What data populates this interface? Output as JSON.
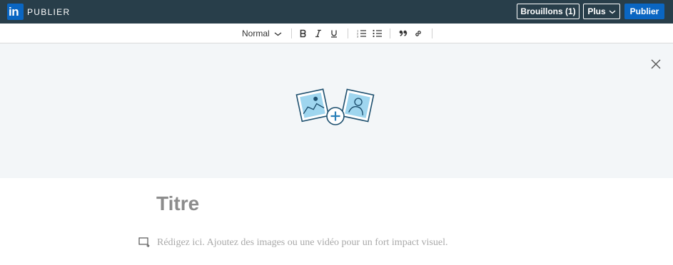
{
  "header": {
    "logo_text": "in",
    "brand_label": "PUBLIER",
    "drafts_label": "Brouillons (1)",
    "more_label": "Plus",
    "publish_label": "Publier"
  },
  "toolbar": {
    "text_style": "Normal",
    "buttons": [
      "bold-icon",
      "italic-icon",
      "underline-icon",
      "numbered-list-icon",
      "bulleted-list-icon",
      "quote-icon",
      "link-icon"
    ]
  },
  "cover": {
    "icons": [
      "close-icon",
      "image-icon",
      "add-icon",
      "profile-photo-icon"
    ]
  },
  "editor": {
    "title_placeholder": "Titre",
    "body_placeholder": "Rédigez ici. Ajoutez des images ou une vidéo pour un fort impact visuel."
  },
  "colors": {
    "header_bg": "#283e4a",
    "accent": "#0a66c2",
    "cover_bg": "#f3f6f8",
    "icon_blue": "#2a7fb8"
  }
}
